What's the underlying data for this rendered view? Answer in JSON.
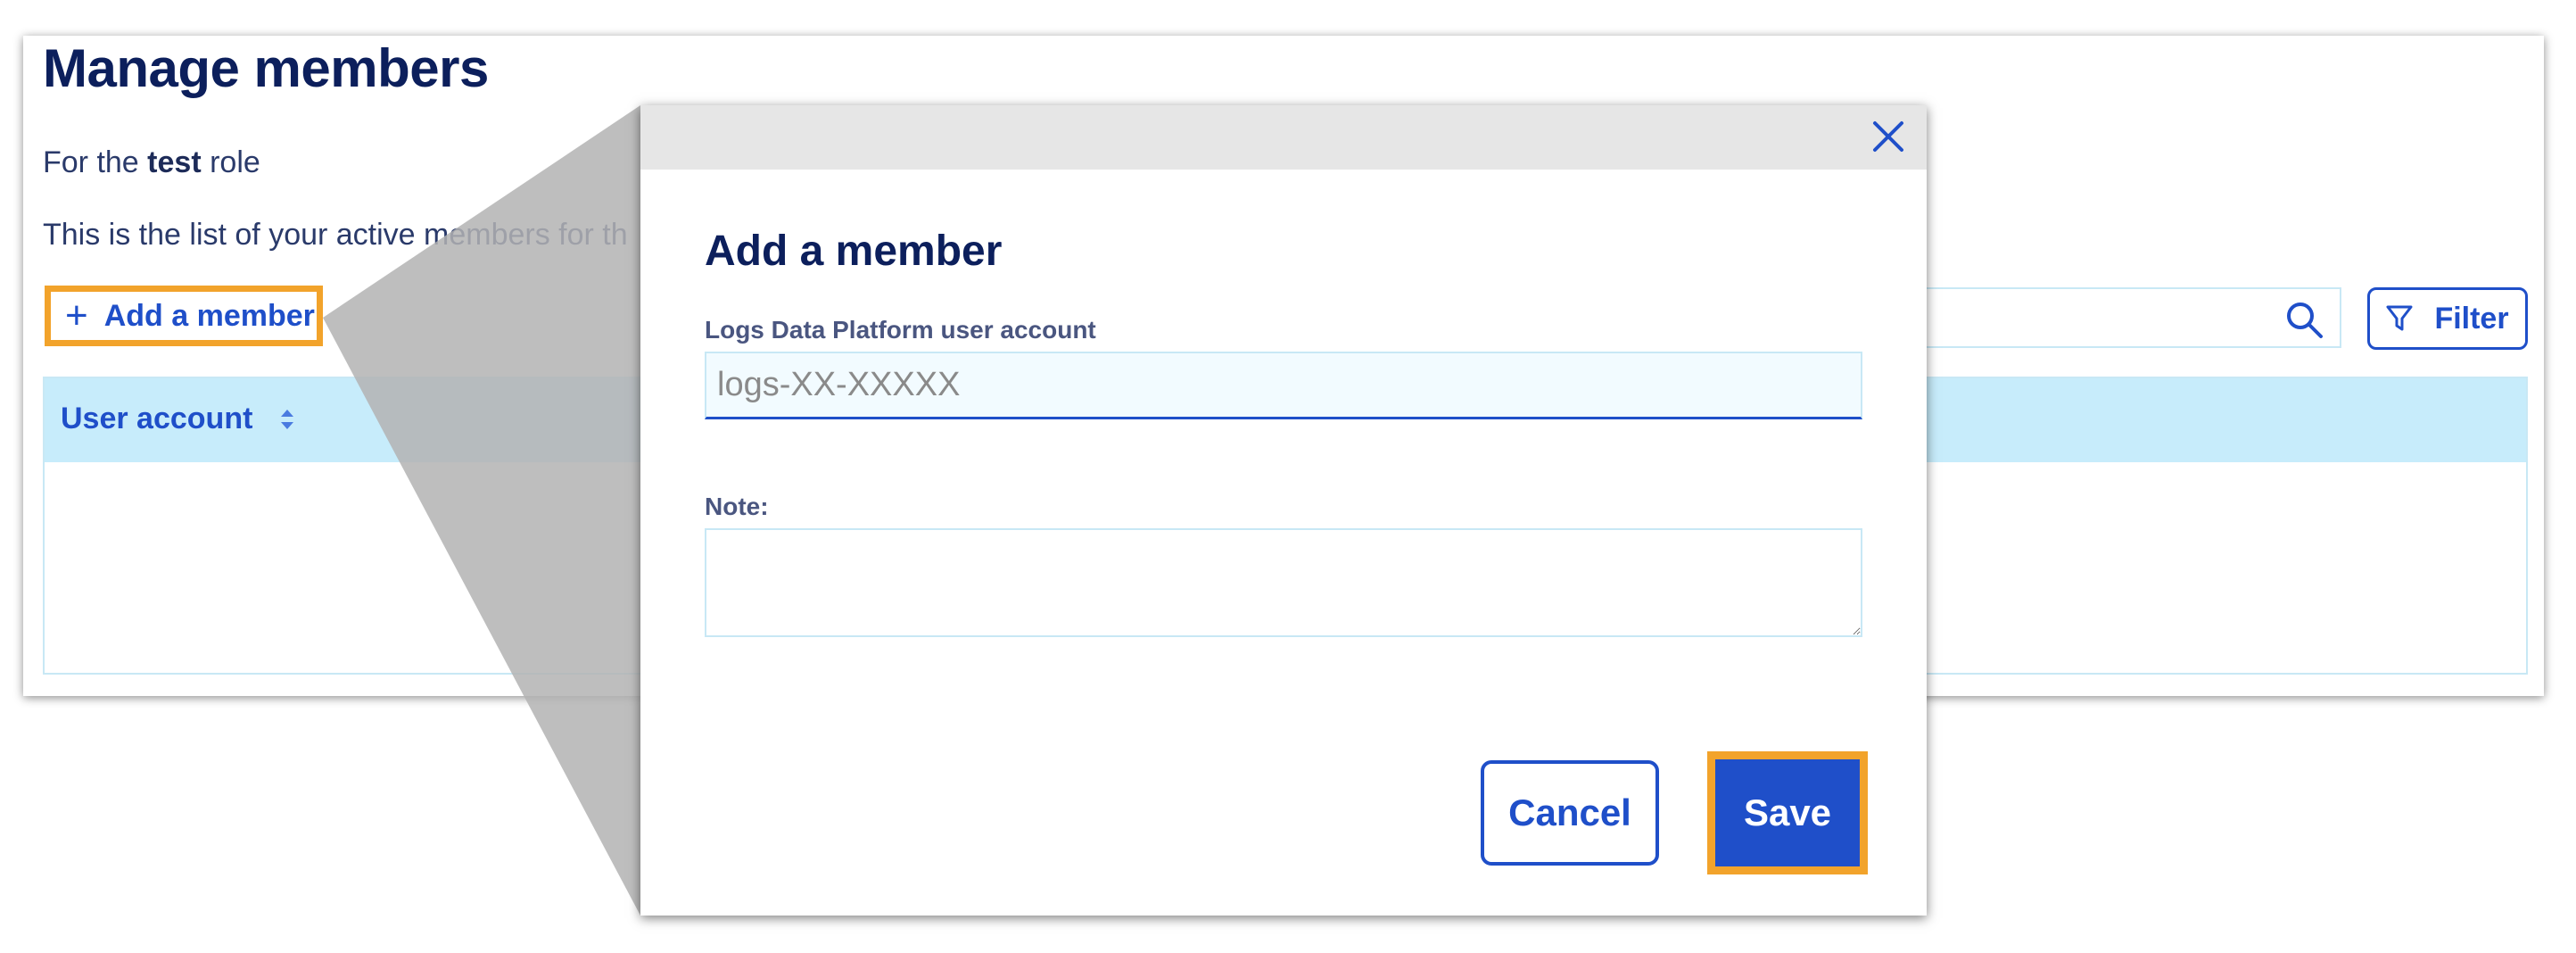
{
  "page": {
    "title": "Manage members",
    "role_prefix": "For the ",
    "role_name": "test",
    "role_suffix": " role",
    "description_visible": "This is the list of your active members for th",
    "description_tail": ".",
    "add_member_label": "Add a member",
    "filter_label": "Filter",
    "table": {
      "columns": [
        "User account"
      ]
    }
  },
  "modal": {
    "title": "Add a member",
    "account_label": "Logs Data Platform user account",
    "account_placeholder": "logs-XX-XXXXX",
    "account_value": "",
    "note_label": "Note:",
    "note_value": "",
    "cancel_label": "Cancel",
    "save_label": "Save"
  },
  "colors": {
    "primary": "#1f4fc9",
    "title": "#0c1f5c",
    "highlight": "#f2a32b",
    "table_header": "#c7ecfb",
    "modal_topbar": "#e6e6e6"
  },
  "icons": [
    "plus-icon",
    "search-icon",
    "filter-icon",
    "sort-icon",
    "close-icon"
  ]
}
